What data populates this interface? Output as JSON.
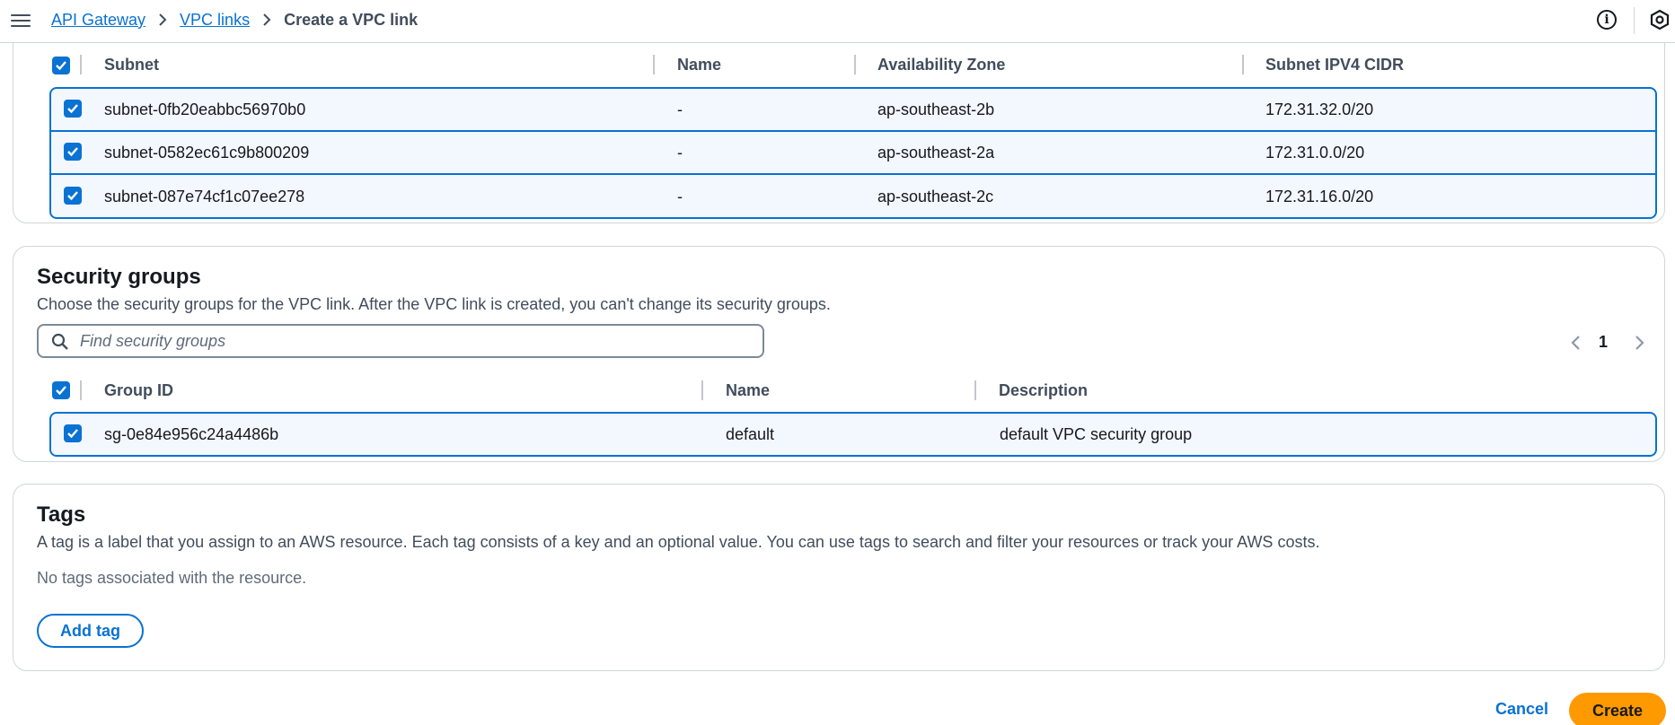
{
  "breadcrumb": {
    "items": [
      {
        "label": "API Gateway"
      },
      {
        "label": "VPC links"
      }
    ],
    "current": "Create a VPC link"
  },
  "subnets": {
    "columns": {
      "subnet": "Subnet",
      "name": "Name",
      "az": "Availability Zone",
      "cidr": "Subnet IPV4 CIDR"
    },
    "rows": [
      {
        "subnet": "subnet-0fb20eabbc56970b0",
        "name": "-",
        "az": "ap-southeast-2b",
        "cidr": "172.31.32.0/20",
        "selected": true
      },
      {
        "subnet": "subnet-0582ec61c9b800209",
        "name": "-",
        "az": "ap-southeast-2a",
        "cidr": "172.31.0.0/20",
        "selected": true
      },
      {
        "subnet": "subnet-087e74cf1c07ee278",
        "name": "-",
        "az": "ap-southeast-2c",
        "cidr": "172.31.16.0/20",
        "selected": true
      }
    ]
  },
  "security_groups": {
    "title": "Security groups",
    "description": "Choose the security groups for the VPC link. After the VPC link is created, you can't change its security groups.",
    "search_placeholder": "Find security groups",
    "page": "1",
    "columns": {
      "group_id": "Group ID",
      "name": "Name",
      "description": "Description"
    },
    "rows": [
      {
        "group_id": "sg-0e84e956c24a4486b",
        "name": "default",
        "description": "default VPC security group",
        "selected": true
      }
    ]
  },
  "tags": {
    "title": "Tags",
    "description": "A tag is a label that you assign to an AWS resource. Each tag consists of a key and an optional value. You can use tags to search and filter your resources or track your AWS costs.",
    "empty_text": "No tags associated with the resource.",
    "add_label": "Add tag"
  },
  "footer": {
    "cancel_label": "Cancel",
    "create_label": "Create"
  },
  "colors": {
    "primary": "#0972d3",
    "selected_row_bg": "#f2f8fd",
    "create_button": "#ff9900"
  },
  "icons": {
    "menu": "hamburger-icon",
    "separator": "chevron-right-icon",
    "info": "info-icon",
    "account": "hexagon-icon",
    "search": "search-icon",
    "prev": "chevron-left-icon",
    "next": "chevron-right-icon",
    "check": "checkmark-icon"
  }
}
